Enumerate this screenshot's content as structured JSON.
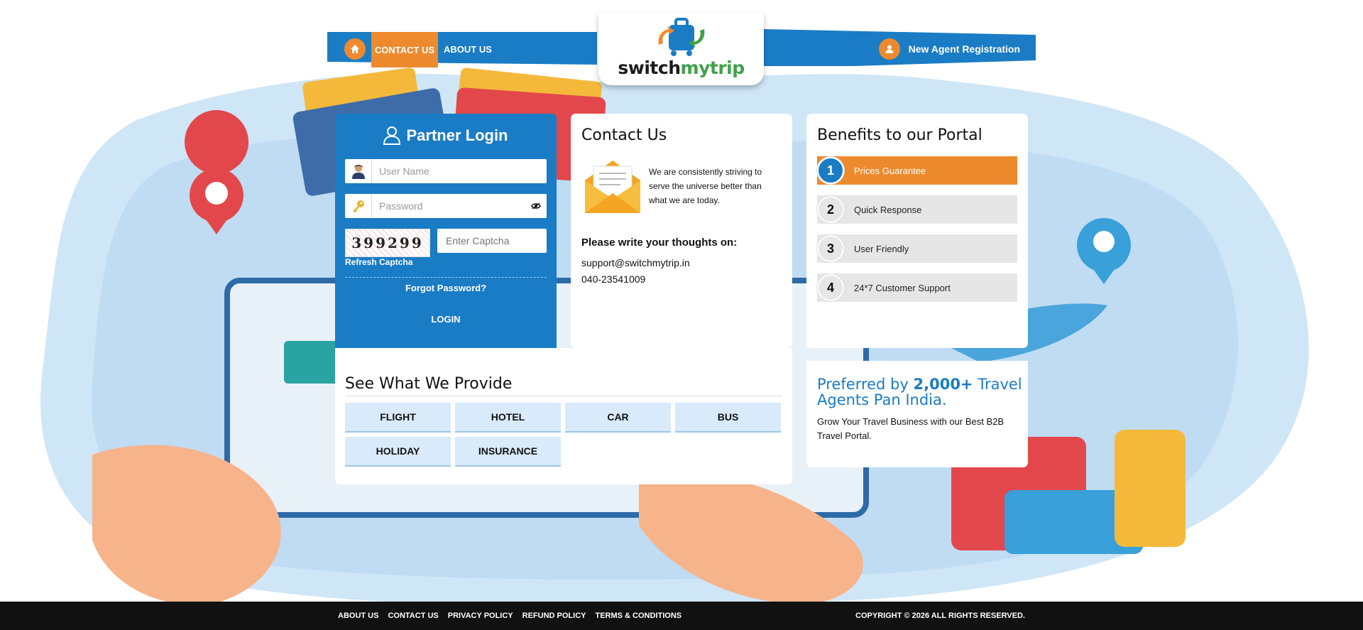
{
  "nav": {
    "contact_label": "CONTACT US",
    "about_label": "ABOUT US",
    "agent_label": "New Agent Registration"
  },
  "logo": {
    "part1": "switch",
    "part2": "mytrip"
  },
  "login": {
    "title": "Partner Login",
    "username_placeholder": "User Name",
    "password_placeholder": "Password",
    "captcha_text": "399299",
    "captcha_placeholder": "Enter Captcha",
    "refresh_label": "Refresh Captcha",
    "forgot_label": "Forgot Password?",
    "login_label": "LOGIN"
  },
  "contact": {
    "title": "Contact Us",
    "description": "We are consistently striving to serve the universe better than what we are today.",
    "write_heading": "Please write your thoughts on:",
    "email": "support@switchmytrip.in",
    "phone": "040-23541009"
  },
  "benefits": {
    "title": "Benefits to our Portal",
    "items": [
      {
        "num": "1",
        "label": "Prices Guarantee"
      },
      {
        "num": "2",
        "label": "Quick Response"
      },
      {
        "num": "3",
        "label": "User Friendly"
      },
      {
        "num": "4",
        "label": "24*7 Customer Support"
      }
    ]
  },
  "provide": {
    "title": "See What We Provide",
    "items": [
      "FLIGHT",
      "HOTEL",
      "CAR",
      "BUS",
      "HOLIDAY",
      "INSURANCE"
    ]
  },
  "preferred": {
    "prefix": "Preferred by ",
    "count": "2,000+",
    "suffix": " Travel Agents Pan India.",
    "description": "Grow Your Travel Business with our Best B2B Travel Portal."
  },
  "footer": {
    "links": [
      "ABOUT US",
      "CONTACT US",
      "PRIVACY POLICY",
      "REFUND POLICY",
      "TERMS & CONDITIONS"
    ],
    "copyright": "COPYRIGHT © 2026 ALL RIGHTS RESERVED."
  },
  "colors": {
    "primary_blue": "#1a7cc5",
    "accent_orange": "#ee8a2e",
    "light_blue": "#d9eafa",
    "footer_bg": "#111111"
  }
}
